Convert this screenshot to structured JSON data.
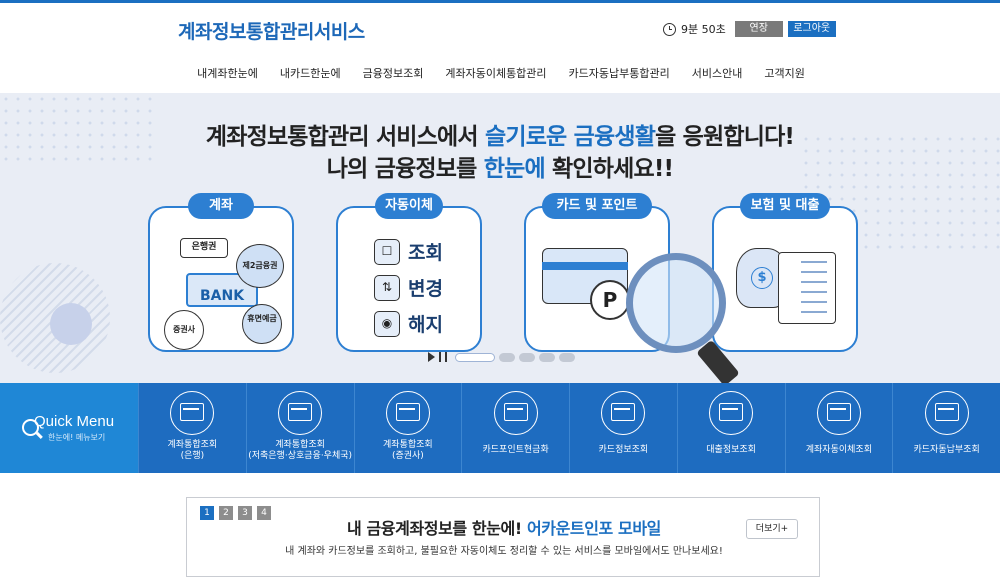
{
  "header": {
    "logo": "계좌정보통합관리서비스",
    "timer": "9분 50초",
    "extend_label": "연장",
    "logout_label": "로그아웃"
  },
  "gnb": [
    "내계좌한눈에",
    "내카드한눈에",
    "금융정보조회",
    "계좌자동이체통합관리",
    "카드자동납부통합관리",
    "서비스안내",
    "고객지원"
  ],
  "hero": {
    "line1_pre": "계좌정보통합관리 서비스에서 ",
    "line1_hl": "슬기로운 금융생활",
    "line1_post": "을 응원합니다!",
    "line2_pre": "나의 금융정보를 ",
    "line2_hl": "한눈에",
    "line2_post": " 확인하세요!!",
    "cards": [
      {
        "tag": "계좌",
        "bubbles": [
          "은행권",
          "제2금융권",
          "증권사",
          "휴면예금"
        ],
        "bank": "BANK"
      },
      {
        "tag": "자동이체",
        "items": [
          "조회",
          "변경",
          "해지"
        ]
      },
      {
        "tag": "카드 및 포인트",
        "coin": "P"
      },
      {
        "tag": "보험 및 대출",
        "coin": "$"
      }
    ],
    "slide_dots": 5,
    "active_slide": 1
  },
  "quick": {
    "title": "Quick Menu",
    "subtitle": "한눈에! 메뉴보기",
    "items": [
      {
        "label1": "계좌통합조회",
        "label2": "(은행)",
        "icon": "bank-icon"
      },
      {
        "label1": "계좌통합조회",
        "label2": "(저축은행·상호금융·우체국)",
        "icon": "bank-computer-icon"
      },
      {
        "label1": "계좌통합조회",
        "label2": "(증권사)",
        "icon": "stock-chart-icon"
      },
      {
        "label1": "카드포인트현금화",
        "label2": "",
        "icon": "card-point-icon"
      },
      {
        "label1": "카드정보조회",
        "label2": "",
        "icon": "card-search-icon"
      },
      {
        "label1": "대출정보조회",
        "label2": "",
        "icon": "loan-document-icon"
      },
      {
        "label1": "계좌자동이체조회",
        "label2": "",
        "icon": "auto-transfer-icon"
      },
      {
        "label1": "카드자동납부조회",
        "label2": "",
        "icon": "card-autopay-icon"
      }
    ]
  },
  "notice": {
    "pages": [
      "1",
      "2",
      "3",
      "4"
    ],
    "active_page": 0,
    "title_pre": "내 금융계좌정보를 한눈에! ",
    "title_hl": "어카운트인포 모바일",
    "desc": "내 계좌와 카드정보를 조회하고, 불필요한 자동이체도 정리할 수 있는 서비스를 모바일에서도 만나보세요!",
    "more_label": "더보기+"
  }
}
